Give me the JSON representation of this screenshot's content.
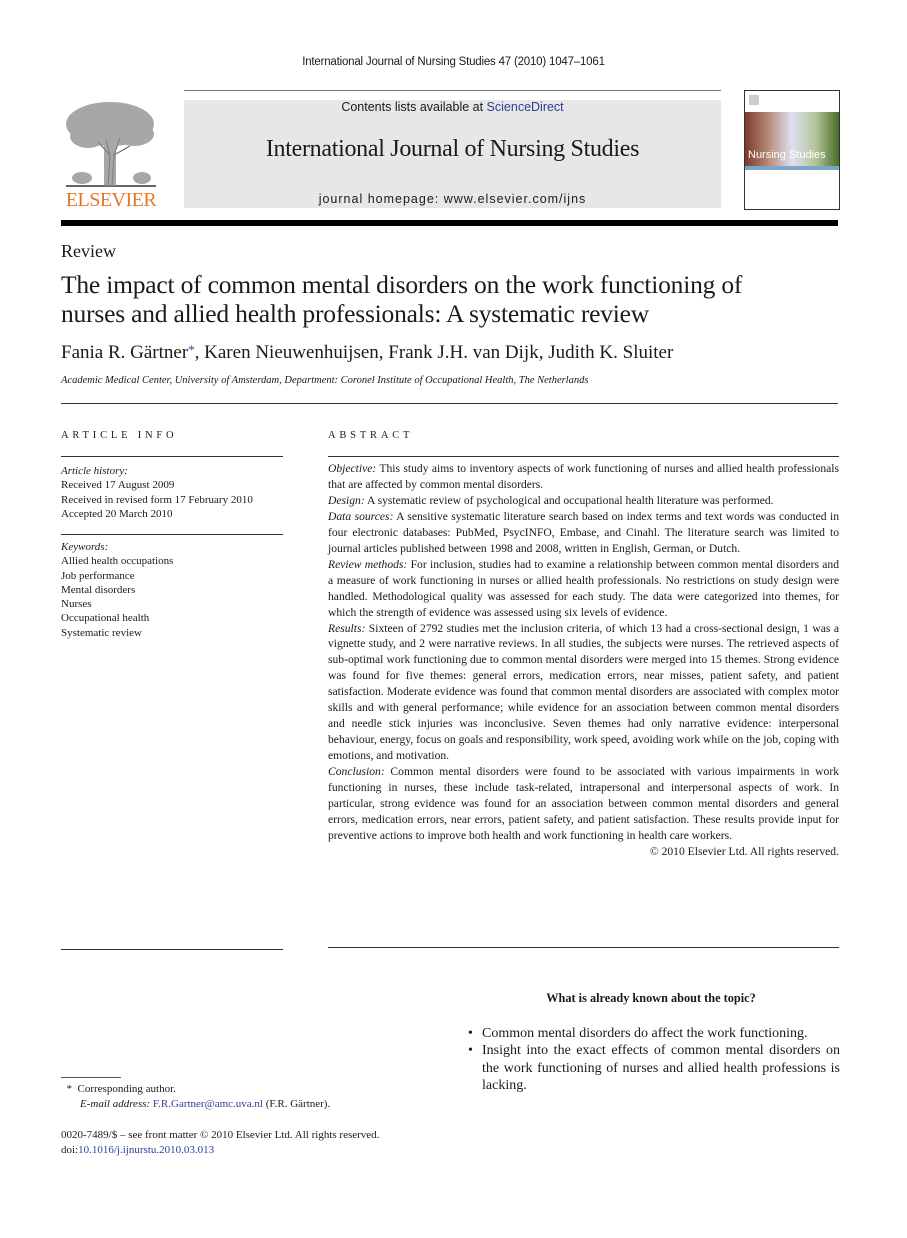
{
  "running_head": "International Journal of Nursing Studies 47 (2010) 1047–1061",
  "masthead": {
    "contents_prefix": "Contents lists available at ",
    "contents_link": "ScienceDirect",
    "journal_name": "International Journal of Nursing Studies",
    "homepage": "journal homepage: www.elsevier.com/ijns",
    "publisher_logo_text": "ELSEVIER",
    "cover_title": "Nursing Studies",
    "colors": {
      "publisher_orange": "#e87722",
      "link_blue": "#2e3f95",
      "masthead_bg": "#e7e7e7"
    }
  },
  "article": {
    "section": "Review",
    "title_line1": "The impact of common mental disorders on the work functioning of",
    "title_line2": "nurses and allied health professionals: A systematic review",
    "authors": [
      {
        "name": "Fania R. Gärtner",
        "marker": "*",
        "sep": ", "
      },
      {
        "name": "Karen Nieuwenhuijsen",
        "sep": ", "
      },
      {
        "name": "Frank J.H. van Dijk",
        "sep": ", "
      },
      {
        "name": "Judith K. Sluiter",
        "sep": ""
      }
    ],
    "affiliation": "Academic Medical Center, University of Amsterdam, Department: Coronel Institute of Occupational Health, The Netherlands"
  },
  "article_info": {
    "heading": "ARTICLE INFO",
    "history_label": "Article history:",
    "history": [
      "Received 17 August 2009",
      "Received in revised form 17 February 2010",
      "Accepted 20 March 2010"
    ],
    "keywords_label": "Keywords:",
    "keywords": [
      "Allied health occupations",
      "Job performance",
      "Mental disorders",
      "Nurses",
      "Occupational health",
      "Systematic review"
    ]
  },
  "abstract": {
    "heading": "ABSTRACT",
    "sections": [
      {
        "label": "Objective:",
        "text": " This study aims to inventory aspects of work functioning of nurses and allied health professionals that are affected by common mental disorders."
      },
      {
        "label": "Design:",
        "text": " A systematic review of psychological and occupational health literature was performed."
      },
      {
        "label": "Data sources:",
        "text": " A sensitive systematic literature search based on index terms and text words was conducted in four electronic databases: PubMed, PsycINFO, Embase, and Cinahl. The literature search was limited to journal articles published between 1998 and 2008, written in English, German, or Dutch."
      },
      {
        "label": "Review methods:",
        "text": " For inclusion, studies had to examine a relationship between common mental disorders and a measure of work functioning in nurses or allied health professionals. No restrictions on study design were handled. Methodological quality was assessed for each study. The data were categorized into themes, for which the strength of evidence was assessed using six levels of evidence."
      },
      {
        "label": "Results:",
        "text": " Sixteen of 2792 studies met the inclusion criteria, of which 13 had a cross-sectional design, 1 was a vignette study, and 2 were narrative reviews. In all studies, the subjects were nurses. The retrieved aspects of sub-optimal work functioning due to common mental disorders were merged into 15 themes. Strong evidence was found for five themes: general errors, medication errors, near misses, patient safety, and patient satisfaction. Moderate evidence was found that common mental disorders are associated with complex motor skills and with general performance; while evidence for an association between common mental disorders and needle stick injuries was inconclusive. Seven themes had only narrative evidence: interpersonal behaviour, energy, focus on goals and responsibility, work speed, avoiding work while on the job, coping with emotions, and motivation."
      },
      {
        "label": "Conclusion:",
        "text": " Common mental disorders were found to be associated with various impairments in work functioning in nurses, these include task-related, intrapersonal and interpersonal aspects of work. In particular, strong evidence was found for an association between common mental disorders and general errors, medication errors, near errors, patient safety, and patient satisfaction. These results provide input for preventive actions to improve both health and work functioning in health care workers."
      }
    ],
    "copyright": "© 2010 Elsevier Ltd. All rights reserved."
  },
  "known_box": {
    "heading": "What is already known about the topic?",
    "bullets": [
      "Common mental disorders do affect the work functioning.",
      "Insight into the exact effects of common mental disorders on the work functioning of nurses and allied health professions is lacking."
    ]
  },
  "footnote": {
    "marker": "*",
    "corresponding": "Corresponding author.",
    "email_label": "E-mail address:",
    "email": "F.R.Gartner@amc.uva.nl",
    "email_suffix": " (F.R. Gärtner)."
  },
  "front_matter": {
    "issn_line": "0020-7489/$ – see front matter © 2010 Elsevier Ltd. All rights reserved.",
    "doi_label": "doi:",
    "doi": "10.1016/j.ijnurstu.2010.03.013"
  }
}
